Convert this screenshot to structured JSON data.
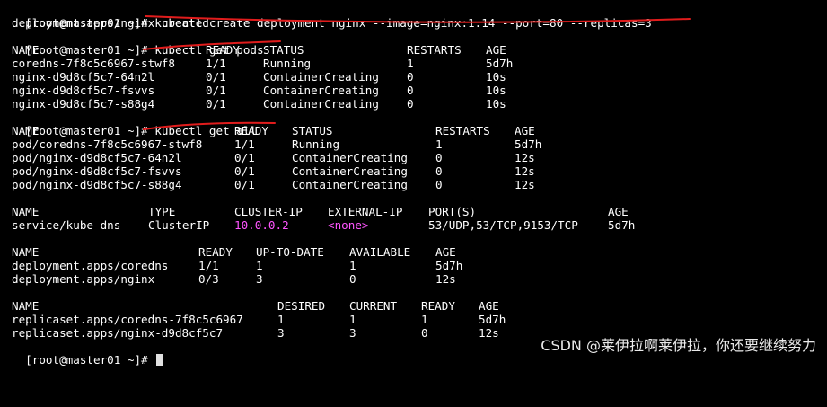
{
  "accent_colors": {
    "magenta": "#ff55ff",
    "underline": "#e01c1c"
  },
  "commands": {
    "create": {
      "prompt": "[root@master01 ~]#",
      "text": "kubectl create deployment nginx --image=nginx:1.14 --port=80 --replicas=3",
      "output": "deployment.apps/nginx created"
    },
    "get_pods": {
      "prompt": "[root@master01 ~]#",
      "text": "kubectl get pods"
    },
    "get_all": {
      "prompt": "[root@master01 ~]#",
      "text": "kubectl get all"
    },
    "final_prompt": "[root@master01 ~]#"
  },
  "pods_table": {
    "headers": [
      "NAME",
      "READY",
      "STATUS",
      "RESTARTS",
      "AGE"
    ],
    "rows": [
      [
        "coredns-7f8c5c6967-stwf8",
        "1/1",
        "Running",
        "1",
        "5d7h"
      ],
      [
        "nginx-d9d8cf5c7-64n2l",
        "0/1",
        "ContainerCreating",
        "0",
        "10s"
      ],
      [
        "nginx-d9d8cf5c7-fsvvs",
        "0/1",
        "ContainerCreating",
        "0",
        "10s"
      ],
      [
        "nginx-d9d8cf5c7-s88g4",
        "0/1",
        "ContainerCreating",
        "0",
        "10s"
      ]
    ]
  },
  "all_pods_table": {
    "headers": [
      "NAME",
      "READY",
      "STATUS",
      "RESTARTS",
      "AGE"
    ],
    "rows": [
      [
        "pod/coredns-7f8c5c6967-stwf8",
        "1/1",
        "Running",
        "1",
        "5d7h"
      ],
      [
        "pod/nginx-d9d8cf5c7-64n2l",
        "0/1",
        "ContainerCreating",
        "0",
        "12s"
      ],
      [
        "pod/nginx-d9d8cf5c7-fsvvs",
        "0/1",
        "ContainerCreating",
        "0",
        "12s"
      ],
      [
        "pod/nginx-d9d8cf5c7-s88g4",
        "0/1",
        "ContainerCreating",
        "0",
        "12s"
      ]
    ]
  },
  "services_table": {
    "headers": [
      "NAME",
      "TYPE",
      "CLUSTER-IP",
      "EXTERNAL-IP",
      "PORT(S)",
      "AGE"
    ],
    "rows": [
      [
        "service/kube-dns",
        "ClusterIP",
        "10.0.0.2",
        "<none>",
        "53/UDP,53/TCP,9153/TCP",
        "5d7h"
      ]
    ]
  },
  "deployments_table": {
    "headers": [
      "NAME",
      "READY",
      "UP-TO-DATE",
      "AVAILABLE",
      "AGE"
    ],
    "rows": [
      [
        "deployment.apps/coredns",
        "1/1",
        "1",
        "1",
        "5d7h"
      ],
      [
        "deployment.apps/nginx",
        "0/3",
        "3",
        "0",
        "12s"
      ]
    ]
  },
  "replicasets_table": {
    "headers": [
      "NAME",
      "DESIRED",
      "CURRENT",
      "READY",
      "AGE"
    ],
    "rows": [
      [
        "replicaset.apps/coredns-7f8c5c6967",
        "1",
        "1",
        "1",
        "5d7h"
      ],
      [
        "replicaset.apps/nginx-d9d8cf5c7",
        "3",
        "3",
        "0",
        "12s"
      ]
    ]
  },
  "watermark": "CSDN @莱伊拉啊莱伊拉，你还要继续努力"
}
